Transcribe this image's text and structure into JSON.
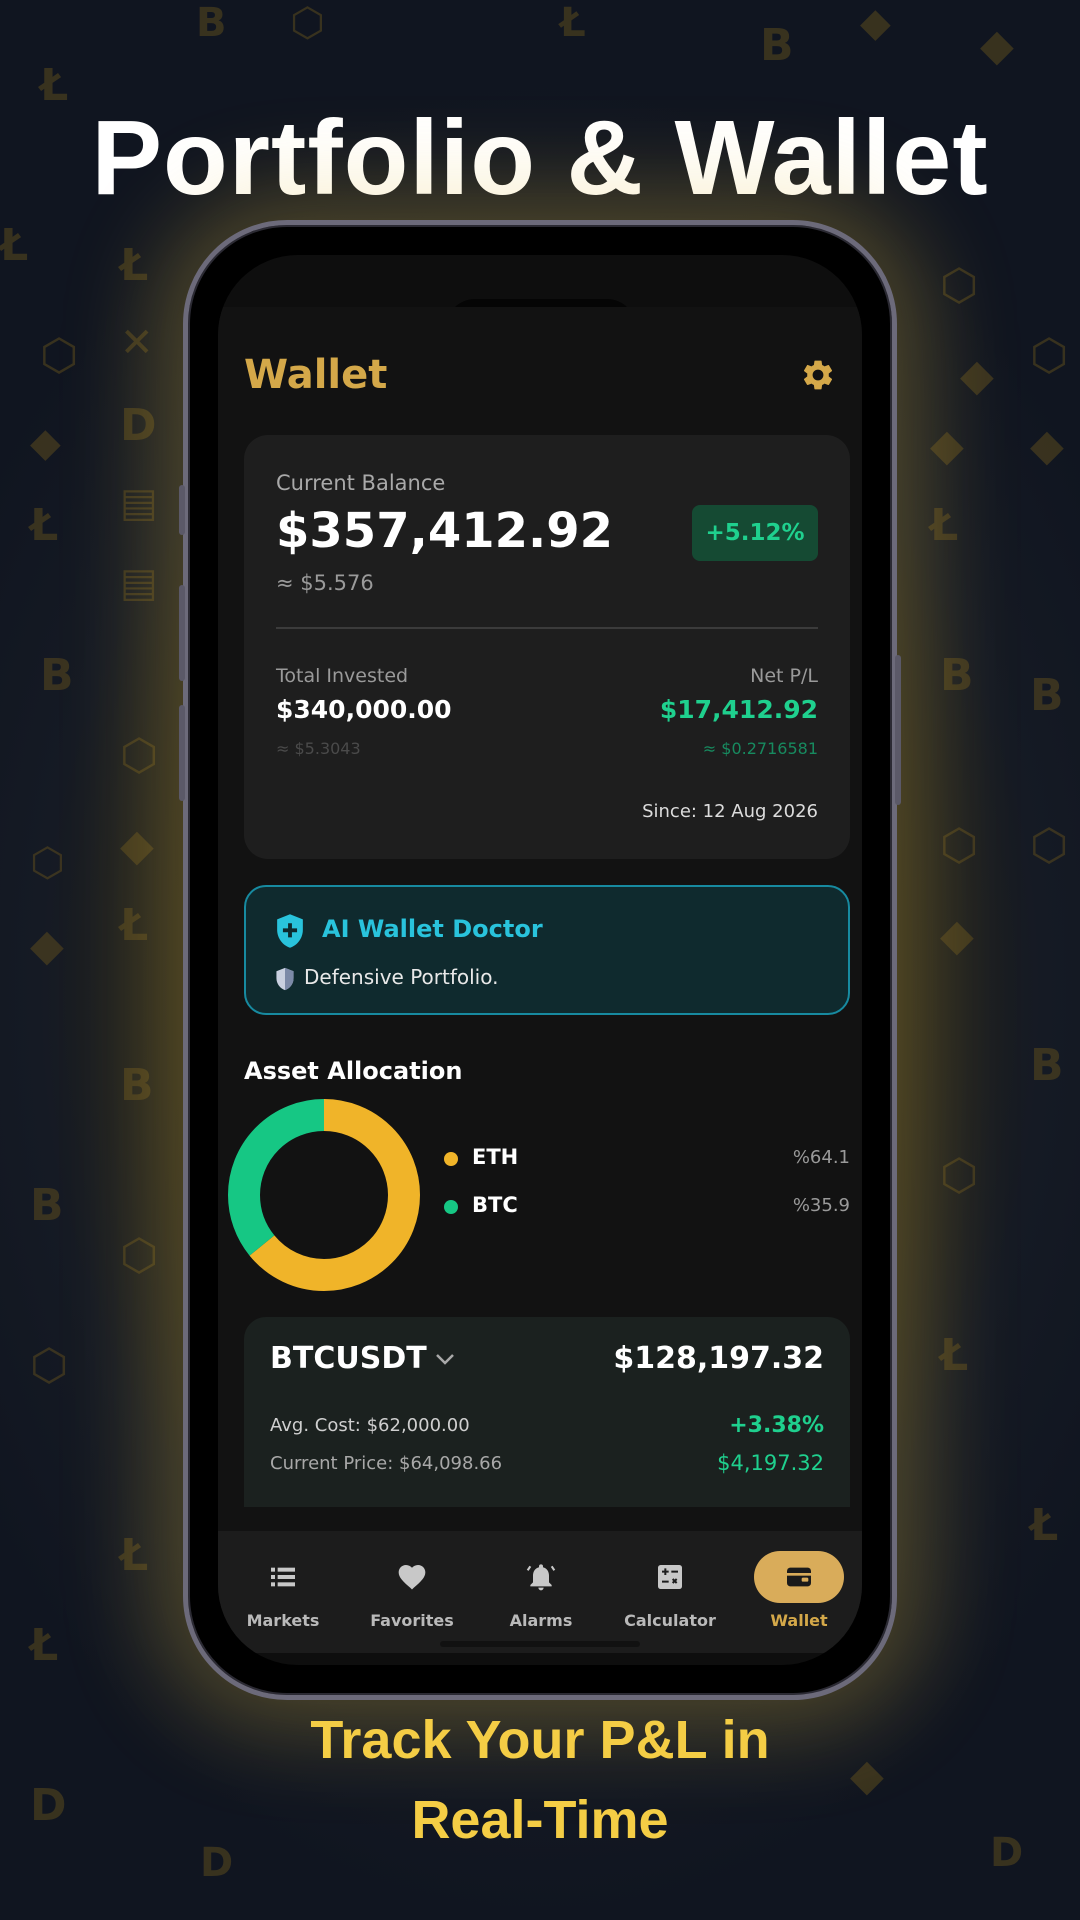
{
  "promo": {
    "headline": "Portfolio & Wallet",
    "tagline_line1": "Track Your P&L in",
    "tagline_line2": "Real-Time"
  },
  "header": {
    "title": "Wallet",
    "settings_icon": "gear-icon"
  },
  "balance": {
    "label": "Current Balance",
    "value": "$357,412.92",
    "approx": "≈ $5.576",
    "change": "+5.12%",
    "total_invested_label": "Total Invested",
    "total_invested_value": "$340,000.00",
    "total_invested_approx": "≈ $5.3043",
    "net_pl_label": "Net P/L",
    "net_pl_value": "$17,412.92",
    "net_pl_approx": "≈ $0.2716581",
    "since": "Since: 12 Aug 2026"
  },
  "doctor": {
    "title": "AI Wallet Doctor",
    "message": "Defensive Portfolio."
  },
  "allocation": {
    "title": "Asset Allocation",
    "items": [
      {
        "name": "ETH",
        "percent": "%64.1",
        "color": "#f0b429",
        "share": 0.641
      },
      {
        "name": "BTC",
        "percent": "%35.9",
        "color": "#16c784",
        "share": 0.359
      }
    ]
  },
  "position": {
    "symbol": "BTCUSDT",
    "value": "$128,197.32",
    "avg_cost": "Avg. Cost: $62,000.00",
    "current_price": "Current Price: $64,098.66",
    "change_pct": "+3.38%",
    "pl": "$4,197.32"
  },
  "nav": {
    "items": [
      {
        "label": "Markets",
        "icon": "list-icon"
      },
      {
        "label": "Favorites",
        "icon": "heart-icon"
      },
      {
        "label": "Alarms",
        "icon": "bell-icon"
      },
      {
        "label": "Calculator",
        "icon": "calculator-icon"
      },
      {
        "label": "Wallet",
        "icon": "wallet-icon"
      }
    ],
    "active": "Wallet"
  },
  "colors": {
    "accent_gold": "#d4a849",
    "profit_green": "#1fd08e",
    "doctor_cyan": "#29c3dc",
    "tagline_yellow": "#f4cd45"
  }
}
